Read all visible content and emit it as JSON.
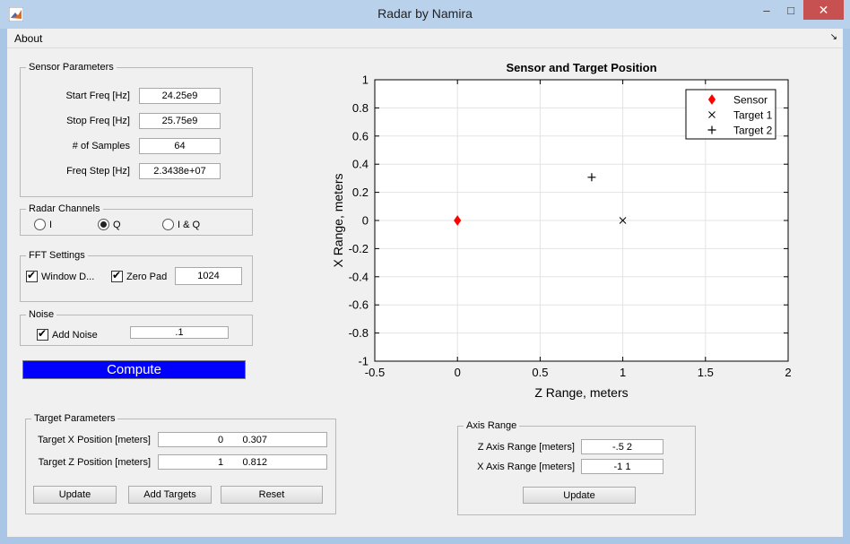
{
  "window": {
    "title": "Radar by Namira",
    "minimize_glyph": "–",
    "maximize_glyph": "□",
    "close_glyph": "✕"
  },
  "menu": {
    "about": "About",
    "corner_glyph": "↘"
  },
  "sensor_parameters": {
    "title": "Sensor Parameters",
    "start_freq_label": "Start Freq [Hz]",
    "start_freq_value": "24.25e9",
    "stop_freq_label": "Stop Freq [Hz]",
    "stop_freq_value": "25.75e9",
    "samples_label": "# of Samples",
    "samples_value": "64",
    "freq_step_label": "Freq Step [Hz]",
    "freq_step_value": "2.3438e+07"
  },
  "radar_channels": {
    "title": "Radar Channels",
    "options": [
      "I",
      "Q",
      "I & Q"
    ],
    "selected": "Q"
  },
  "fft_settings": {
    "title": "FFT Settings",
    "window_label": "Window D...",
    "window_checked": true,
    "zero_pad_label": "Zero Pad",
    "zero_pad_checked": true,
    "zero_pad_value": "1024"
  },
  "noise": {
    "title": "Noise",
    "add_noise_label": "Add Noise",
    "add_noise_checked": true,
    "noise_value": ".1"
  },
  "compute_label": "Compute",
  "target_parameters": {
    "title": "Target Parameters",
    "x_label": "Target X Position [meters]",
    "x_value": "0       0.307",
    "z_label": "Target Z Position [meters]",
    "z_value": "1       0.812",
    "update_label": "Update",
    "add_targets_label": "Add Targets",
    "reset_label": "Reset"
  },
  "axis_range": {
    "title": "Axis Range",
    "z_label": "Z Axis Range [meters]",
    "z_value": "-.5 2",
    "x_label": "X Axis Range [meters]",
    "x_value": "-1 1",
    "update_label": "Update"
  },
  "chart_data": {
    "type": "scatter",
    "title": "Sensor and Target Position",
    "xlabel": "Z Range, meters",
    "ylabel": "X Range, meters",
    "xlim": [
      -0.5,
      2
    ],
    "ylim": [
      -1,
      1
    ],
    "xticks": [
      -0.5,
      0,
      0.5,
      1,
      1.5,
      2
    ],
    "yticks": [
      -1,
      -0.8,
      -0.6,
      -0.4,
      -0.2,
      0,
      0.2,
      0.4,
      0.6,
      0.8,
      1
    ],
    "xtick_labels": [
      "-0.5",
      "0",
      "0.5",
      "1",
      "1.5",
      "2"
    ],
    "ytick_labels": [
      "-1",
      "-0.8",
      "-0.6",
      "-0.4",
      "-0.2",
      "0",
      "0.2",
      "0.4",
      "0.6",
      "0.8",
      "1"
    ],
    "grid": true,
    "legend_position": "top-right",
    "series": [
      {
        "name": "Sensor",
        "marker": "diamond",
        "color": "#ff0000",
        "x": [
          0
        ],
        "y": [
          0
        ]
      },
      {
        "name": "Target 1",
        "marker": "x",
        "color": "#000000",
        "x": [
          1
        ],
        "y": [
          0
        ]
      },
      {
        "name": "Target 2",
        "marker": "plus",
        "color": "#000000",
        "x": [
          0.812
        ],
        "y": [
          0.307
        ]
      }
    ]
  }
}
